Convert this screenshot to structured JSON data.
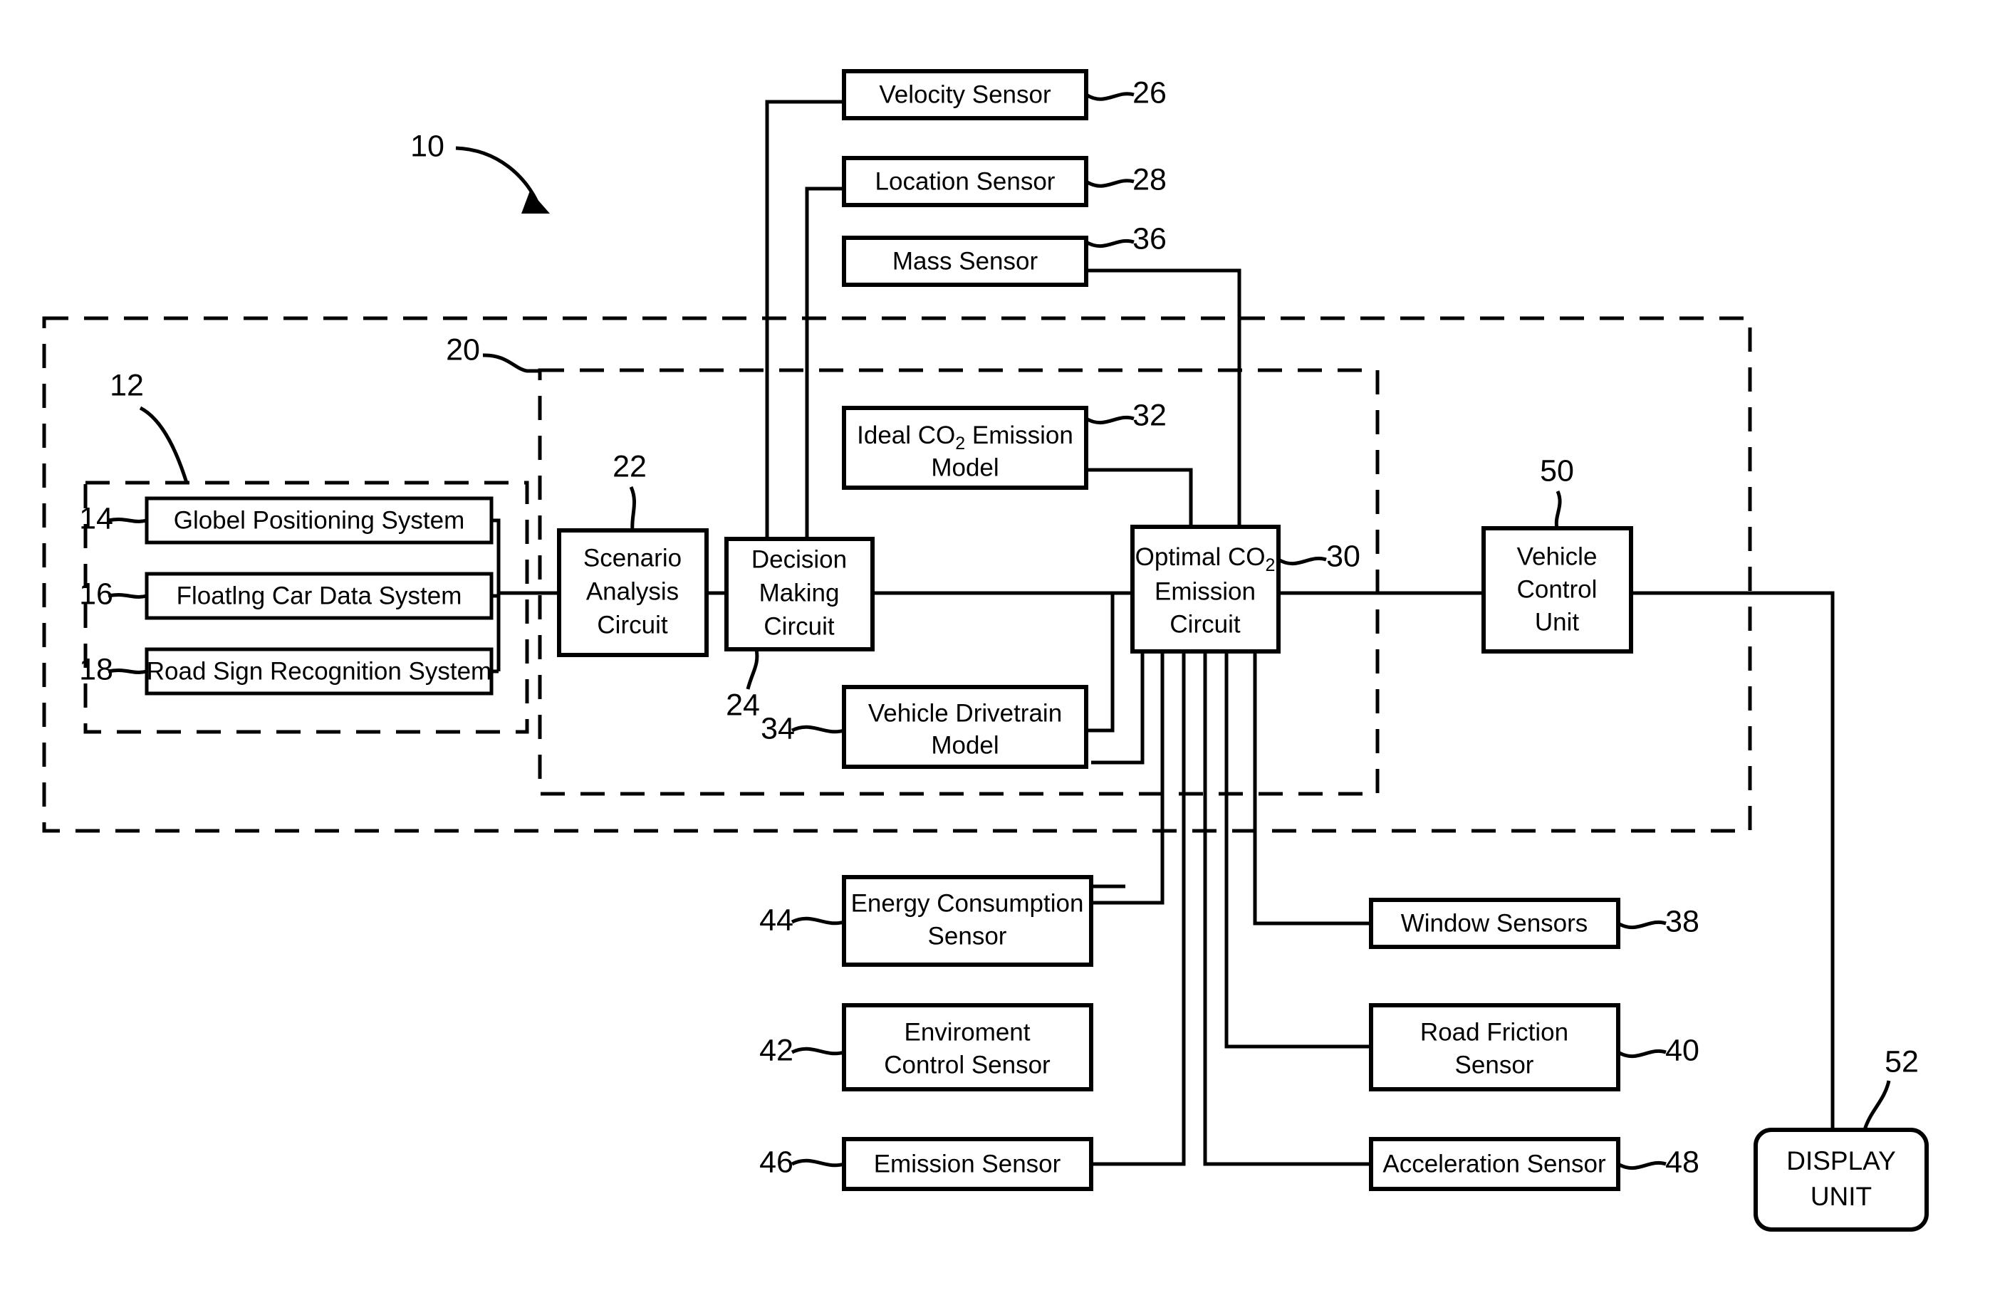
{
  "figure": {
    "system_ref": "10",
    "outer_enclosure_ref": "20"
  },
  "groups": {
    "information_sources": {
      "ref": "12"
    },
    "processing_unit": {
      "ref": "20"
    }
  },
  "boxes": {
    "gps": {
      "label": "Globel Positioning System",
      "ref": "14"
    },
    "fcd": {
      "label": "Floatlng Car Data System",
      "ref": "16"
    },
    "rsr": {
      "label": "Road Sign Recognition System",
      "ref": "18"
    },
    "scenario": {
      "line1": "Scenario",
      "line2": "Analysis",
      "line3": "Circuit",
      "ref": "22"
    },
    "decision": {
      "line1": "Decision",
      "line2": "Making",
      "line3": "Circuit",
      "ref": "24"
    },
    "velocity": {
      "label": "Velocity Sensor",
      "ref": "26"
    },
    "location": {
      "label": "Location Sensor",
      "ref": "28"
    },
    "optimal": {
      "line1a": "Optimal CO",
      "line1sub": "2",
      "line2": "Emission",
      "line3": "Circuit",
      "ref": "30"
    },
    "ideal_model": {
      "line1a": "Ideal CO",
      "line1sub": "2",
      "line1b": " Emission",
      "line2": "Model",
      "ref": "32"
    },
    "drivetrain": {
      "line1": "Vehicle Drivetrain",
      "line2": "Model",
      "ref": "34"
    },
    "mass": {
      "label": "Mass Sensor",
      "ref": "36"
    },
    "window": {
      "label": "Window Sensors",
      "ref": "38"
    },
    "friction": {
      "line1": "Road Friction",
      "line2": "Sensor",
      "ref": "40"
    },
    "environment": {
      "line1": "Enviroment",
      "line2": "Control Sensor",
      "ref": "42"
    },
    "energy": {
      "line1": "Energy Consumption",
      "line2": "Sensor",
      "ref": "44"
    },
    "emission": {
      "label": "Emission Sensor",
      "ref": "46"
    },
    "acceleration": {
      "label": "Acceleration Sensor",
      "ref": "48"
    },
    "vcu": {
      "line1": "Vehicle",
      "line2": "Control",
      "line3": "Unit",
      "ref": "50"
    },
    "display": {
      "line1": "DISPLAY",
      "line2": "UNIT",
      "ref": "52"
    }
  },
  "colors": {
    "ink": "#000000",
    "paper": "#ffffff"
  }
}
